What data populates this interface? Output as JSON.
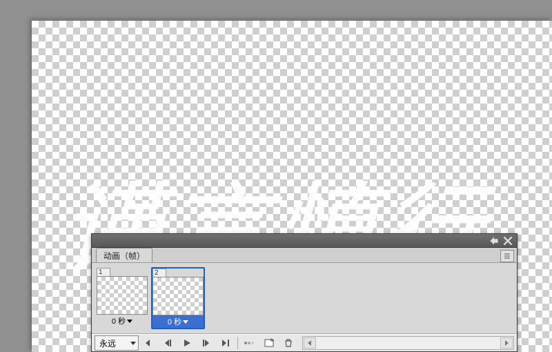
{
  "canvas": {
    "watermark_text": "谨言慎行"
  },
  "animation_panel": {
    "tab_label": "动画（帧）",
    "loop_label": "永远",
    "frames": [
      {
        "index": "1",
        "delay": "0 秒",
        "selected": false
      },
      {
        "index": "2",
        "delay": "0 秒",
        "selected": true
      }
    ],
    "icons": {
      "collapse": "collapse-icon",
      "close": "close-icon",
      "menu": "panel-menu-icon",
      "first": "first-frame-icon",
      "prev": "prev-frame-icon",
      "play": "play-icon",
      "next": "next-frame-icon",
      "last": "last-frame-icon",
      "tween": "tween-icon",
      "new": "new-frame-icon",
      "delete": "delete-frame-icon"
    }
  }
}
